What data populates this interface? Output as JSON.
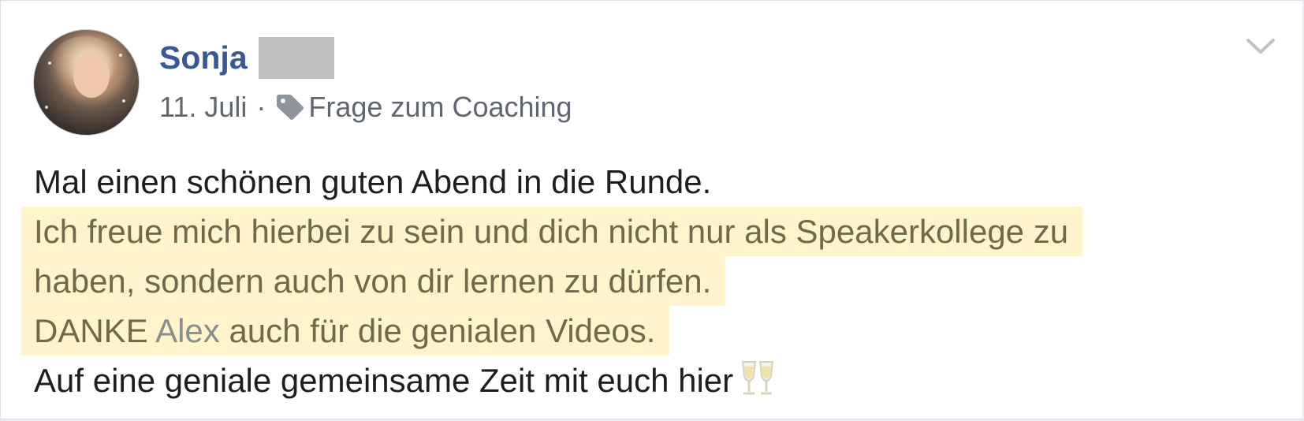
{
  "post": {
    "author": "Sonja",
    "date": "11. Juli",
    "separator": "·",
    "topic": "Frage zum Coaching",
    "lines": {
      "l1": "Mal einen schönen guten Abend in die Runde.",
      "l2": "Ich freue mich hierbei zu sein und dich nicht nur als Speakerkollege zu",
      "l3": "haben, sondern auch von dir lernen zu dürfen.",
      "l4_pre": "DANKE",
      "l4_mention": "Alex",
      "l4_post": "auch für die genialen Videos.",
      "l5": "Auf eine geniale gemeinsame Zeit mit euch hier"
    },
    "emoji": "clinking-glasses",
    "highlight_color": "#fff4cc",
    "name_color": "#385898"
  }
}
